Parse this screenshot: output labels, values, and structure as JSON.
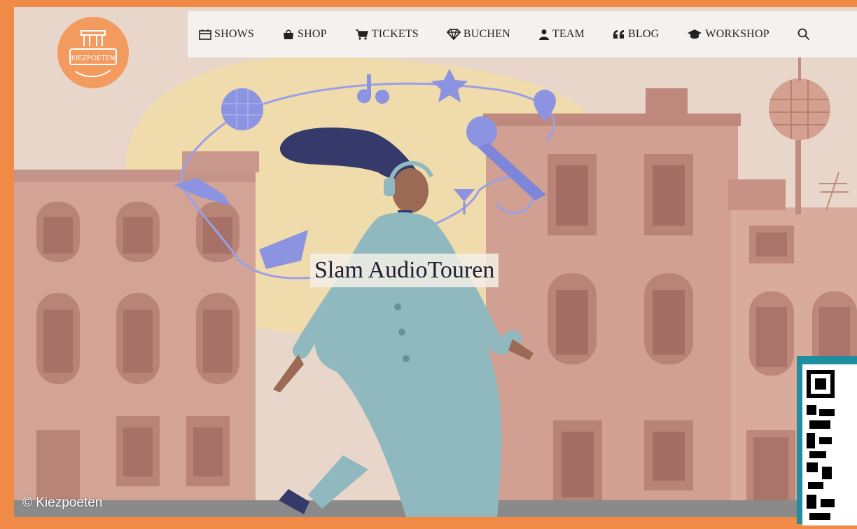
{
  "nav": {
    "items": [
      {
        "label": "SHOWS",
        "icon": "calendar-icon"
      },
      {
        "label": "SHOP",
        "icon": "shopping-bag-icon"
      },
      {
        "label": "TICKETS",
        "icon": "cart-icon"
      },
      {
        "label": "BUCHEN",
        "icon": "diamond-icon"
      },
      {
        "label": "TEAM",
        "icon": "user-icon"
      },
      {
        "label": "BLOG",
        "icon": "quote-icon"
      },
      {
        "label": "WORKSHOP",
        "icon": "graduation-cap-icon"
      }
    ],
    "search_icon": "search-icon"
  },
  "logo": {
    "text": "KIEZPOETEN",
    "icon": "brandenburg-gate-icon"
  },
  "hero": {
    "title": "Slam AudioTouren"
  },
  "copyright": "© Kiezpoeten",
  "colors": {
    "frame": "#ef8a47",
    "logo": "#f39a5f",
    "building": "#d4a396",
    "coat": "#8fb9bf",
    "accent_purple": "#8c93e0",
    "glow": "#f1dca0"
  }
}
